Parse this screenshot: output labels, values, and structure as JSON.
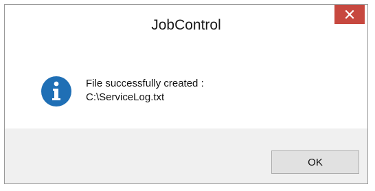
{
  "window": {
    "title": "JobControl",
    "close_icon": "close-icon"
  },
  "message": {
    "icon": "info-icon",
    "line1": "File successfully created :",
    "line2": "C:\\ServiceLog.txt"
  },
  "buttons": {
    "ok_label": "OK"
  },
  "colors": {
    "close_button": "#c7483f",
    "info_icon": "#1f6fb5",
    "footer": "#f0f0f0"
  }
}
